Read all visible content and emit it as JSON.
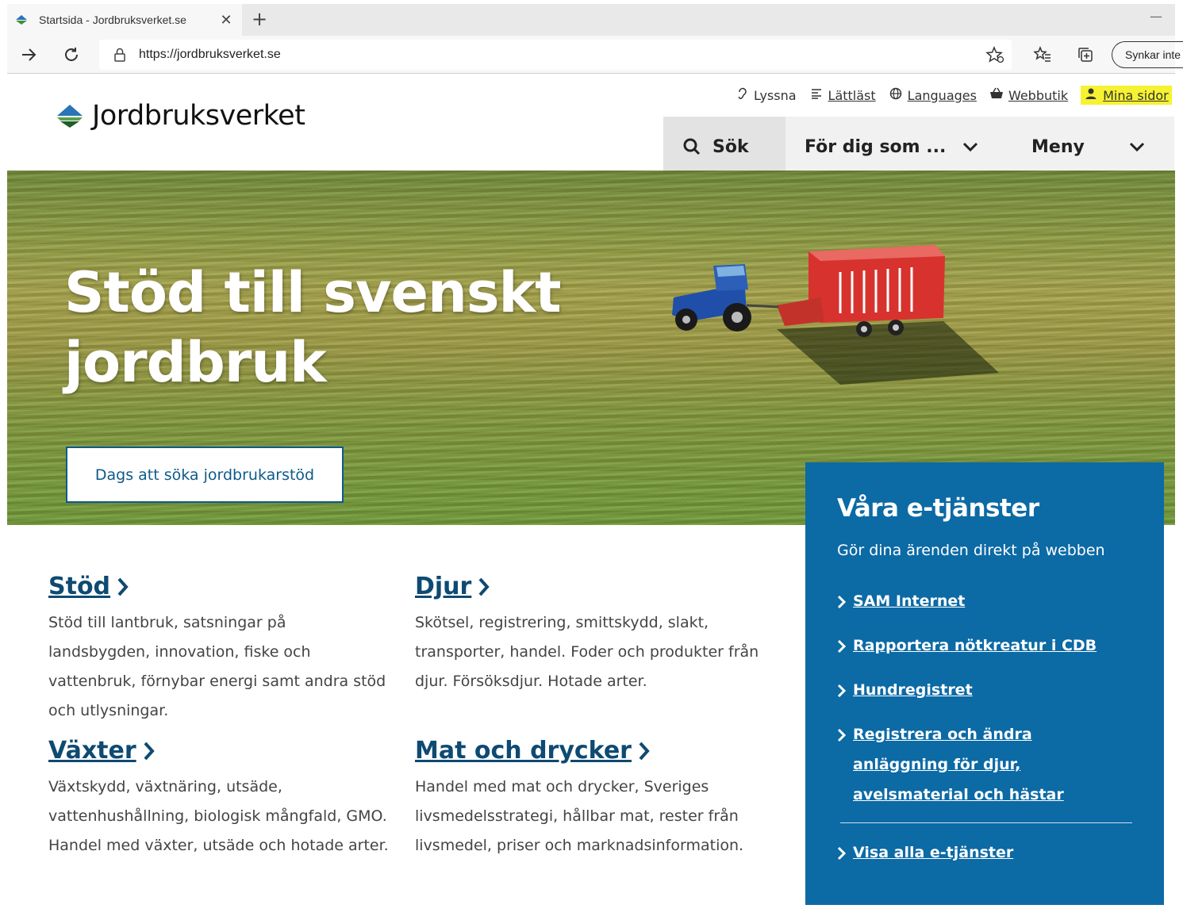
{
  "browser": {
    "tab_title": "Startsida - Jordbruksverket.se",
    "url": "https://jordbruksverket.se",
    "sync_label": "Synkar inte"
  },
  "site": {
    "logo_text": "Jordbruksverket",
    "top_links": {
      "listen": "Lyssna",
      "easy_read": "Lättläst",
      "languages": "Languages",
      "webshop": "Webbutik",
      "my_pages": "Mina sidor"
    },
    "nav": {
      "search": "Sök",
      "for_you": "För dig som ...",
      "menu": "Meny"
    }
  },
  "hero": {
    "title_line1": "Stöd till svenskt",
    "title_line2": "jordbruk",
    "cta": "Dags att söka jordbrukarstöd"
  },
  "categories": [
    {
      "title": "Stöd",
      "desc": "Stöd till lantbruk, satsningar på landsbygden, innovation, fiske och vattenbruk, förnybar energi samt andra stöd och utlysningar."
    },
    {
      "title": "Djur",
      "desc": "Skötsel, registrering, smittskydd, slakt, transporter, handel. Foder och produkter från djur. Försöksdjur. Hotade arter."
    },
    {
      "title": "Växter",
      "desc": "Växtskydd, växtnäring, utsäde, vattenhushållning, biologisk mångfald, GMO. Handel med växter, utsäde och hotade arter."
    },
    {
      "title": "Mat och drycker",
      "desc": "Handel med mat och drycker, Sveriges livsmedelsstrategi, hållbar mat, rester från livsmedel, priser och marknadsinformation."
    }
  ],
  "eservices": {
    "title": "Våra e-tjänster",
    "subtitle": "Gör dina ärenden direkt på webben",
    "links": [
      "SAM Internet",
      "Rapportera nötkreatur i CDB",
      "Hundregistret",
      "Registrera och ändra anläggning för djur, avelsmaterial och hästar"
    ],
    "all_link": "Visa alla e-tjänster"
  },
  "colors": {
    "brand_blue": "#0c6aa5",
    "link_dark": "#0e4a72",
    "highlight": "#f6f231"
  }
}
